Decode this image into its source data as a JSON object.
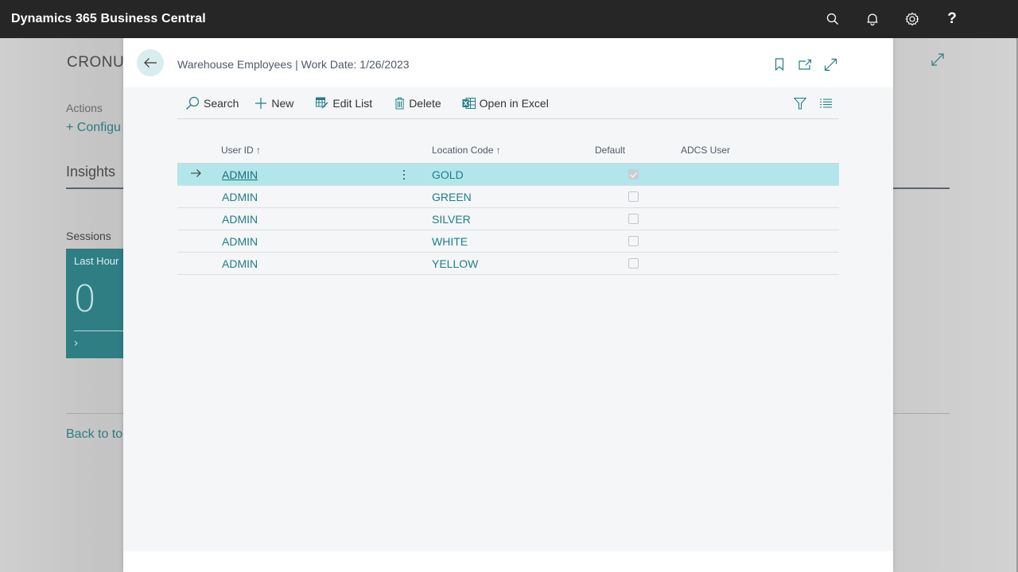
{
  "appbar": {
    "title": "Dynamics 365 Business Central",
    "icons": [
      "search-icon",
      "bell-icon",
      "gear-icon",
      "help-icon"
    ],
    "help_glyph": "?"
  },
  "background_page": {
    "company": "CRONU",
    "actions_label": "Actions",
    "configure_label": "+ Configu",
    "insights_label": "Insights",
    "sessions_label": "Sessions",
    "tile": {
      "label": "Last Hour",
      "value": "0",
      "chevron": "›"
    },
    "back_link": "Back to to"
  },
  "modal": {
    "title": "Warehouse Employees | Work Date: 1/26/2023",
    "header_icons": [
      "bookmark-icon",
      "open-new-window-icon",
      "expand-icon"
    ],
    "toolbar": {
      "search": "Search",
      "new": "New",
      "edit_list": "Edit List",
      "delete": "Delete",
      "open_in_excel": "Open in Excel"
    },
    "grid": {
      "columns": {
        "user_id": "User ID ↑",
        "location_code": "Location Code ↑",
        "default": "Default",
        "adcs_user": "ADCS User"
      },
      "rows": [
        {
          "user_id": "ADMIN",
          "location_code": "GOLD",
          "default": true,
          "adcs_user": "",
          "selected": true
        },
        {
          "user_id": "ADMIN",
          "location_code": "GREEN",
          "default": false,
          "adcs_user": ""
        },
        {
          "user_id": "ADMIN",
          "location_code": "SILVER",
          "default": false,
          "adcs_user": ""
        },
        {
          "user_id": "ADMIN",
          "location_code": "WHITE",
          "default": false,
          "adcs_user": ""
        },
        {
          "user_id": "ADMIN",
          "location_code": "YELLOW",
          "default": false,
          "adcs_user": ""
        }
      ]
    }
  },
  "colors": {
    "accent": "#1d7f86",
    "appbar_bg": "#262626",
    "selected_row": "#b2e6ea",
    "tile_bg": "#2e7e84"
  }
}
